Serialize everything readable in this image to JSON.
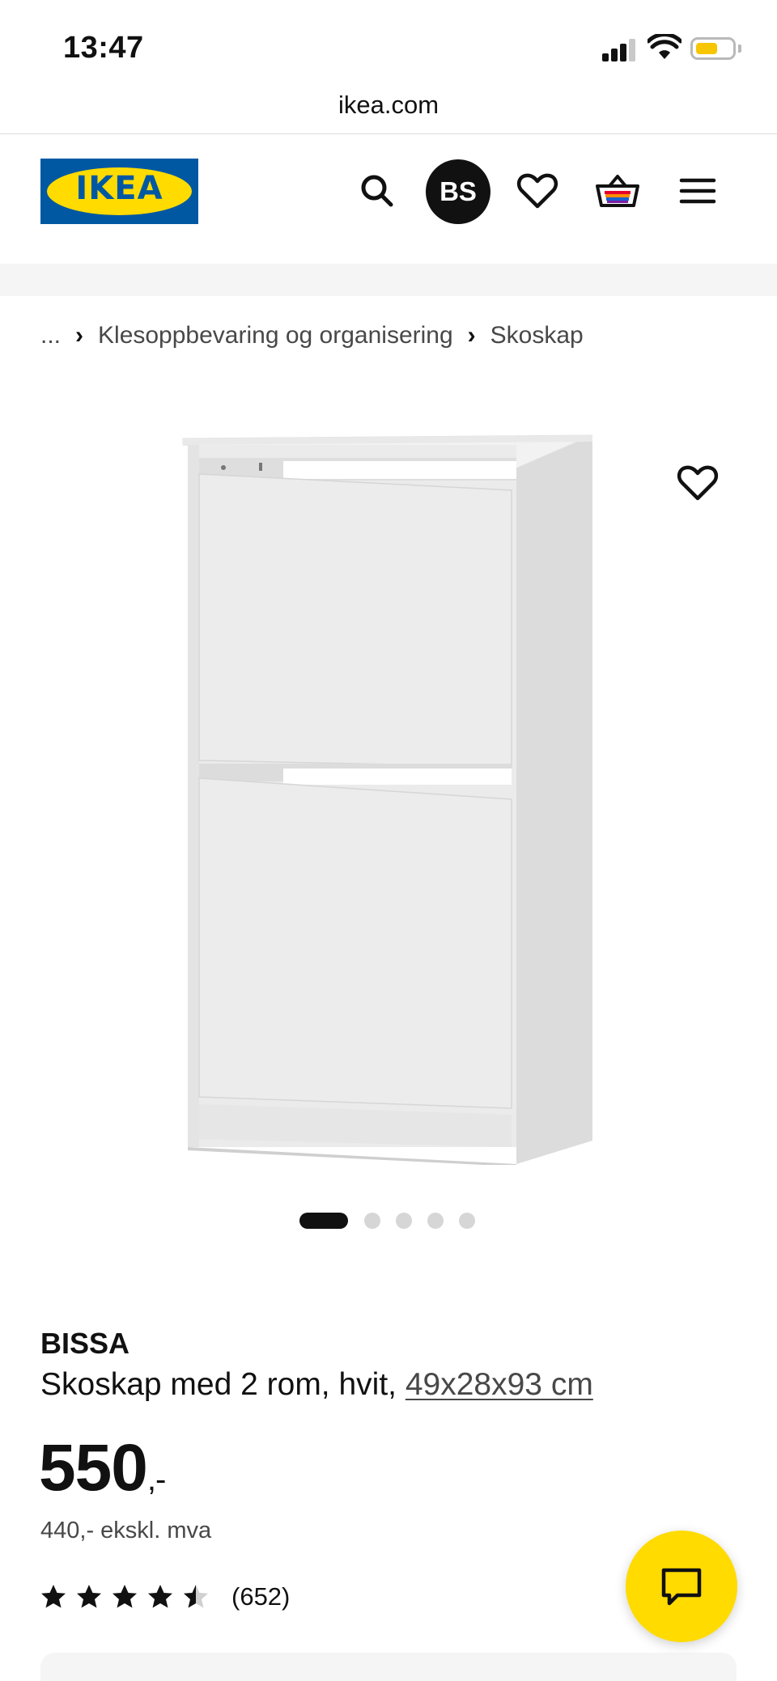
{
  "status_bar": {
    "time": "13:47",
    "icons": [
      "signal-icon",
      "wifi-icon",
      "battery-icon"
    ],
    "battery_color": "#f7c600"
  },
  "browser": {
    "url": "ikea.com"
  },
  "header": {
    "logo_text": "IKEA",
    "logo_colors": {
      "blue": "#0058a3",
      "yellow": "#ffdb00"
    },
    "avatar_initials": "BS",
    "icons": [
      "search-icon",
      "heart-icon",
      "basket-icon",
      "menu-icon"
    ]
  },
  "breadcrumb": {
    "ellipsis": "...",
    "items": [
      "Klesoppbevaring og organisering",
      "Skoskap"
    ]
  },
  "gallery": {
    "image_alt": "product-image",
    "page_count": 5,
    "active_index": 0
  },
  "product": {
    "name": "BISSA",
    "description": "Skoskap med 2 rom, hvit,",
    "dimensions": "49x28x93 cm",
    "price_main": "550",
    "price_suffix": ",-",
    "price_ex_vat": "440,- ekskl. mva",
    "rating_value": 4.5,
    "rating_max": 5,
    "rating_count": "(652)"
  },
  "chat": {
    "icon": "chat-icon",
    "color": "#ffdb00"
  }
}
